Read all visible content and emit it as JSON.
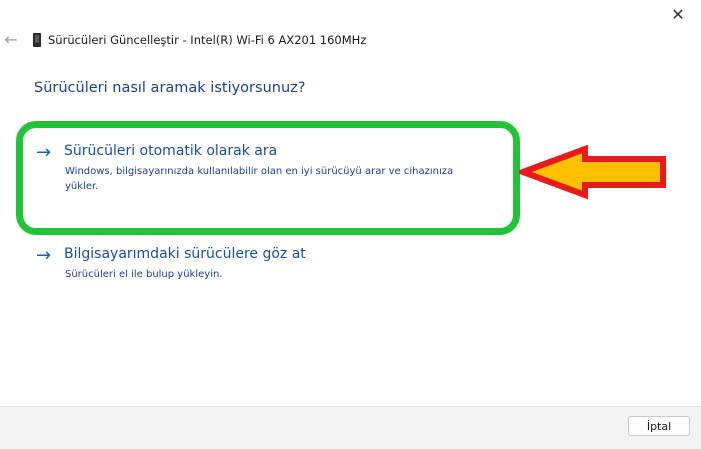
{
  "window": {
    "title": "Sürücüleri Güncelleştir - Intel(R) Wi-Fi 6 AX201 160MHz",
    "close_glyph": "✕",
    "back_glyph": "←",
    "device_icon": "phone-device-icon"
  },
  "main": {
    "heading": "Sürücüleri nasıl aramak istiyorsunuz?",
    "options": [
      {
        "arrow_glyph": "→",
        "title": "Sürücüleri otomatik olarak ara",
        "description": "Windows, bilgisayarınızda kullanılabilir olan en iyi sürücüyü arar ve cihazınıza yükler."
      },
      {
        "arrow_glyph": "→",
        "title": "Bilgisayarımdaki sürücülere göz at",
        "description": "Sürücüleri el ile bulup yükleyin."
      }
    ]
  },
  "footer": {
    "cancel_label": "İptal"
  },
  "colors": {
    "highlight_box": "#22c33a",
    "callout_arrow_fill": "#ffc000",
    "callout_arrow_stroke": "#e81a1a",
    "link_blue": "#1a4fa0",
    "heading_blue": "#1f3f8f"
  }
}
